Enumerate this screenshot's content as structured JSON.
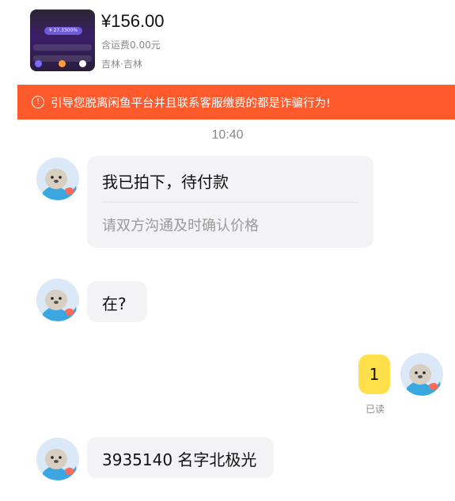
{
  "product": {
    "price": "¥156.00",
    "shipping": "含运费0.00元",
    "location": "吉林·吉林",
    "thumb_badge": "¥ 27.3300%"
  },
  "warning": {
    "icon": "info-icon",
    "text": "引导您脱离闲鱼平台并且联系客服缴费的都是诈骗行为!"
  },
  "chat": {
    "timestamp": "10:40",
    "messages": [
      {
        "sender": "other",
        "title": "我已拍下，待付款",
        "subtitle": "请双方沟通及时确认价格"
      },
      {
        "sender": "other",
        "text": "在?"
      },
      {
        "sender": "me",
        "text": "1",
        "status": "已读"
      },
      {
        "sender": "other",
        "text": "3935140 名字北极光"
      }
    ]
  },
  "colors": {
    "banner": "#ff5a2c",
    "my_bubble": "#ffe04b",
    "other_bubble": "#f3f3f5"
  }
}
